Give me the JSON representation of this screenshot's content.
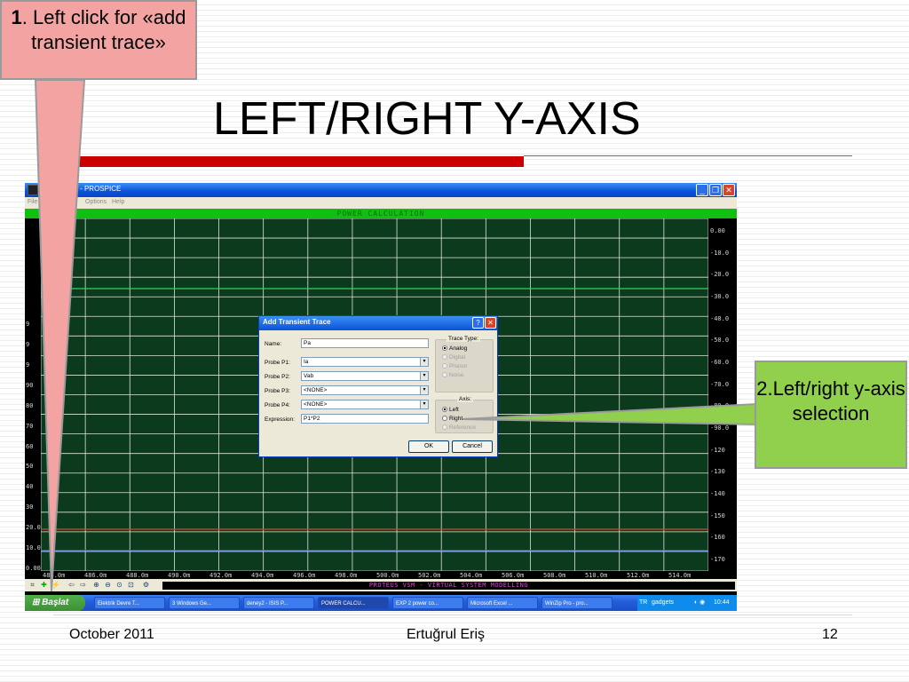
{
  "slide": {
    "title": "LEFT/RIGHT Y-AXIS",
    "footer": {
      "date": "October 2011",
      "author": "Ertuğrul Eriş",
      "page_number": "12"
    }
  },
  "callouts": {
    "step1": {
      "number": "1",
      "text": ". Left click for «add transient trace»"
    },
    "step2": {
      "text": "2.Left/right y-axis selection"
    }
  },
  "window": {
    "title": "CULATION - PROSPICE",
    "menu": [
      "File",
      "Options",
      "Help"
    ],
    "graph_title": "POWER CALCULATION",
    "status_text": "PROTEUS VSM - VIRTUAL SYSTEM MODELLING",
    "y_left_labels": [
      "9",
      "9",
      "9",
      "90",
      "80",
      "70",
      "60",
      "50",
      "40",
      "30",
      "20.0",
      "10.0",
      "0.00"
    ],
    "y_right_labels": [
      "0.00",
      "-10.0",
      "-20.0",
      "-30.0",
      "-40.0",
      "-50.0",
      "-60.0",
      "-70.0",
      "-80.0",
      "-90.0",
      "-120",
      "-130",
      "-140",
      "-150",
      "-160",
      "-170"
    ],
    "x_labels": [
      "484.0m",
      "486.0m",
      "488.0m",
      "490.0m",
      "492.0m",
      "494.0m",
      "496.0m",
      "498.0m",
      "500.0m",
      "502.0m",
      "504.0m",
      "506.0m",
      "508.0m",
      "510.0m",
      "512.0m",
      "514.0m"
    ]
  },
  "dialog": {
    "title": "Add Transient Trace",
    "fields": {
      "name_label": "Name:",
      "name_value": "Pa",
      "p1_label": "Probe P1:",
      "p1_value": "Ia",
      "p2_label": "Probe P2:",
      "p2_value": "Vab",
      "p3_label": "Probe P3:",
      "p3_value": "<NONE>",
      "p4_label": "Probe P4:",
      "p4_value": "<NONE>",
      "expr_label": "Expression:",
      "expr_value": "P1*P2"
    },
    "trace_type": {
      "title": "Trace Type:",
      "options": [
        "Analog",
        "Digital",
        "Phasor",
        "Noise"
      ],
      "selected": "Analog"
    },
    "axis": {
      "title": "Axis:",
      "options": [
        "Left",
        "Right",
        "Reference"
      ],
      "selected": "Left"
    },
    "ok_label": "OK",
    "cancel_label": "Cancel"
  },
  "taskbar": {
    "start_label": "Başlat",
    "items": [
      "Elektrik Devre T...",
      "3 Windows Ge...",
      "deney2 - ISIS P...",
      "POWER CALCU...",
      "EXP 2 power co...",
      "Microsoft Excel ...",
      "WinZip Pro - pro...",
      "gadgets"
    ],
    "tray_lang": "TR",
    "clock": "10:44"
  },
  "colors": {
    "title_rule": "#cc0000",
    "plot_bg": "#0c3a1c",
    "callout1_bg": "#f4a3a3",
    "callout2_bg": "#90d04c"
  }
}
